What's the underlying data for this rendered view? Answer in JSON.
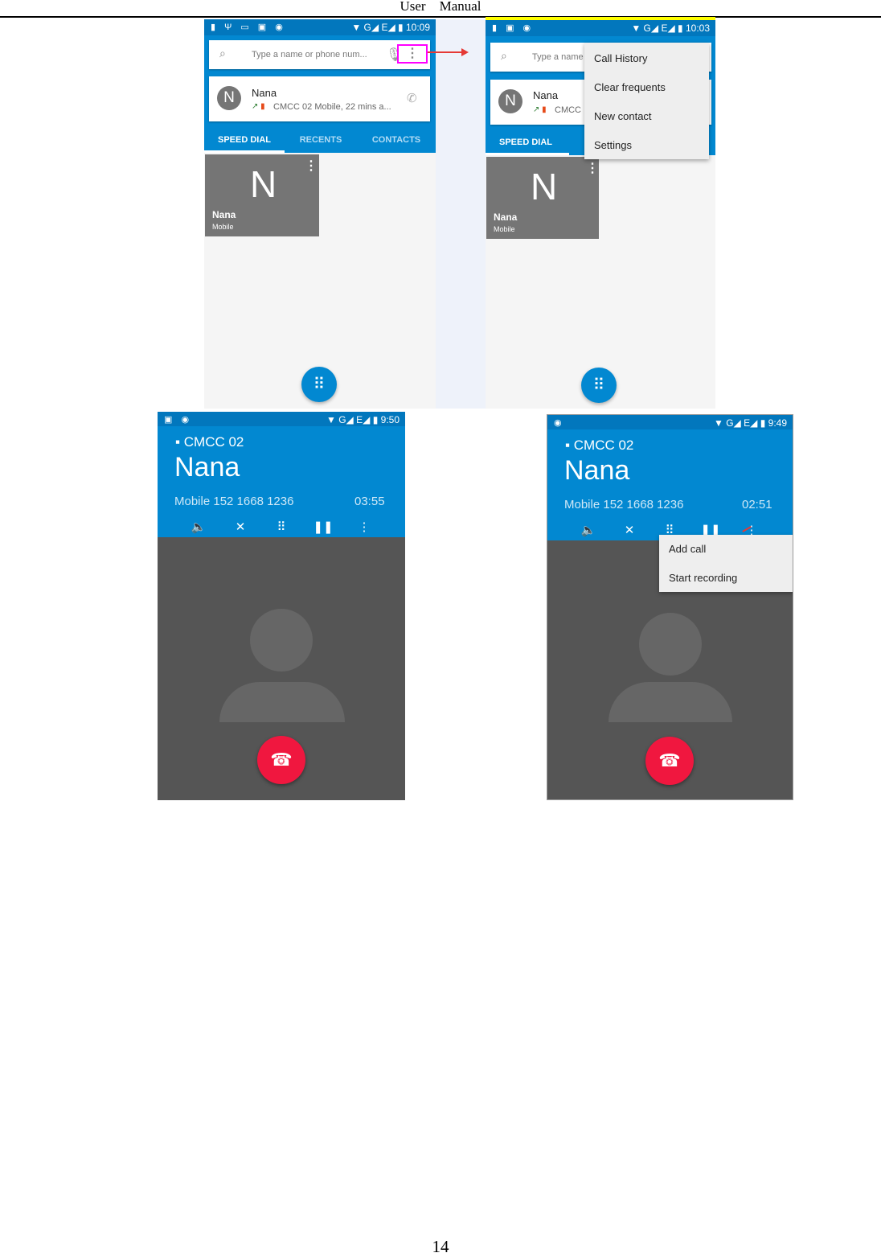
{
  "page": {
    "header": "User    Manual",
    "page_number": "14"
  },
  "dialer": {
    "status_time_1": "10:09",
    "status_time_2": "10:03",
    "status_signal": "G◢ E◢",
    "search_placeholder": "Type a name or phone num...",
    "search_placeholder_short": "Type a name",
    "recent_name": "Nana",
    "recent_avatar": "N",
    "recent_detail": "CMCC 02 Mobile, 22 mins a...",
    "recent_detail_short": "CMCC",
    "tabs": [
      "SPEED DIAL",
      "RECENTS",
      "CONTACTS"
    ],
    "tile_letter": "N",
    "tile_name": "Nana",
    "tile_type": "Mobile",
    "menu": [
      "Call History",
      "Clear frequents",
      "New contact",
      "Settings"
    ]
  },
  "call": {
    "status_time_1": "9:50",
    "status_time_2": "9:49",
    "sim": "CMCC 02",
    "name": "Nana",
    "number": "Mobile 152 1668 1236",
    "duration_1": "03:55",
    "duration_2": "02:51",
    "menu": [
      "Add call",
      "Start recording"
    ]
  },
  "colors": {
    "primary": "#0288d1",
    "status": "#0277bd",
    "end_call": "#f0173f",
    "highlight": "#ff00ff",
    "arrow": "#e53935"
  }
}
